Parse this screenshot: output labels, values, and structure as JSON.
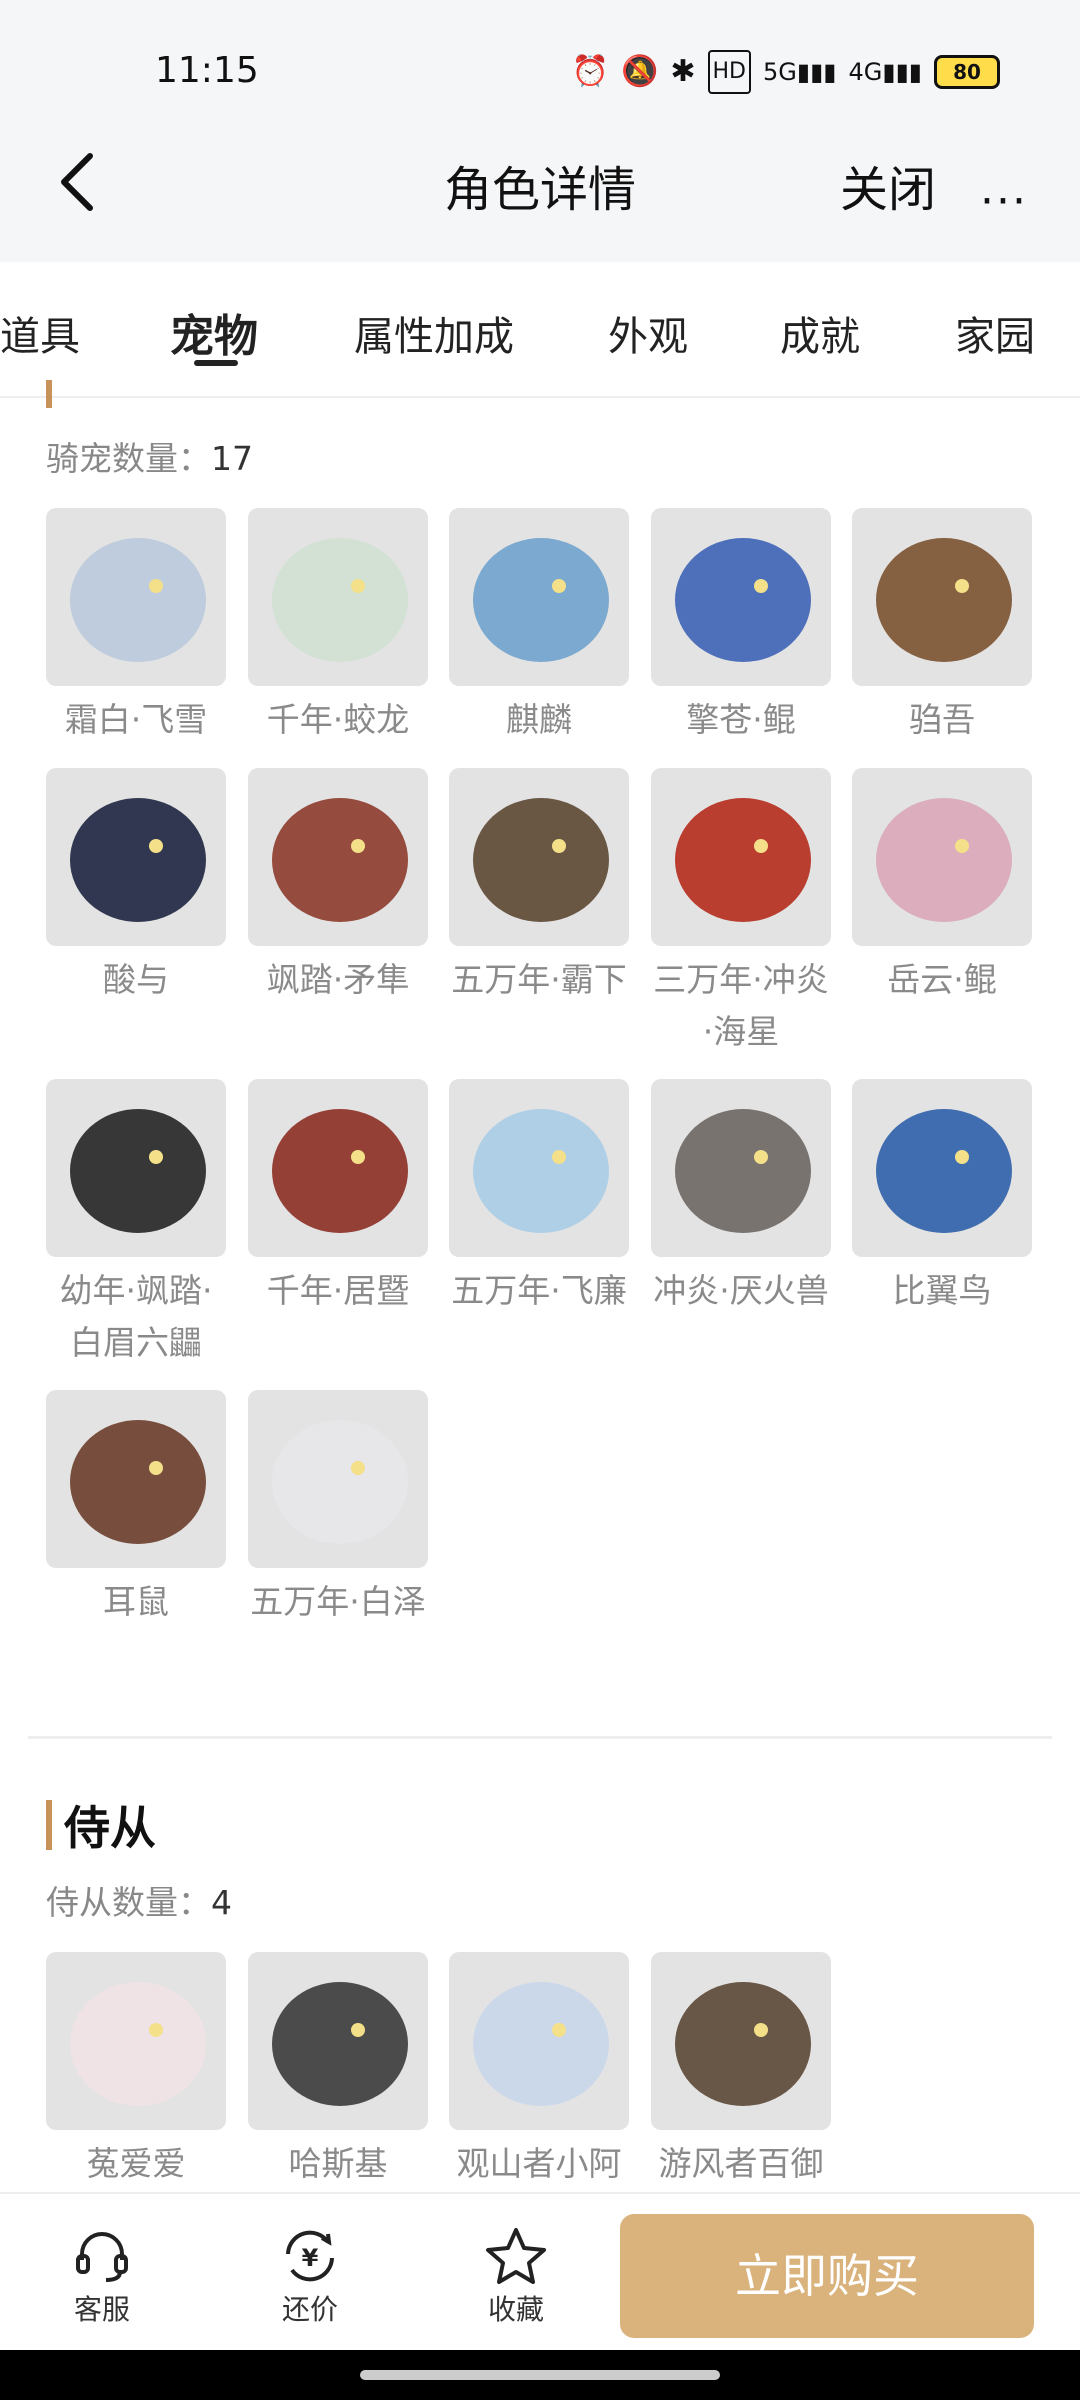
{
  "status": {
    "time": "11:15",
    "battery": "80"
  },
  "header": {
    "title": "角色详情",
    "close_label": "关闭",
    "more_label": "···"
  },
  "tabs": [
    "道具",
    "宠物",
    "属性加成",
    "外观",
    "成就",
    "家园"
  ],
  "mounts": {
    "count_label": "骑宠数量：",
    "count_value": "17",
    "items": [
      {
        "label": "霜白·飞雪",
        "color": "#b9c9dd"
      },
      {
        "label": "千年·蛟龙",
        "color": "#cfe0d2"
      },
      {
        "label": "麒麟",
        "color": "#6fa2cc"
      },
      {
        "label": "擎苍·鲲",
        "color": "#3d62b5"
      },
      {
        "label": "驺吾",
        "color": "#7a5230"
      },
      {
        "label": "酸与",
        "color": "#1d2340"
      },
      {
        "label": "飒踏·矛隼",
        "color": "#8c3a2a"
      },
      {
        "label": "五万年·霸下",
        "color": "#5b4732"
      },
      {
        "label": "三万年·冲炎·海星",
        "color": "#b42b1c"
      },
      {
        "label": "岳云·鲲",
        "color": "#d9a6b8"
      },
      {
        "label": "幼年·飒踏·白眉六鼺",
        "color": "#232323"
      },
      {
        "label": "千年·居暨",
        "color": "#8c2e24"
      },
      {
        "label": "五万年·飞廉",
        "color": "#a9cce6"
      },
      {
        "label": "冲炎·厌火兽",
        "color": "#6b6662"
      },
      {
        "label": "比翼鸟",
        "color": "#2d5fa8"
      },
      {
        "label": "耳鼠",
        "color": "#6a3d2a"
      },
      {
        "label": "五万年·白泽",
        "color": "#e7e7ea"
      }
    ]
  },
  "attendants": {
    "title": "侍从",
    "count_label": "侍从数量：",
    "count_value": "4",
    "items": [
      {
        "label": "菟爱爱",
        "color": "#f0e2e6"
      },
      {
        "label": "哈斯基",
        "color": "#3a3a3a"
      },
      {
        "label": "观山者小阿",
        "color": "#c8d6ea"
      },
      {
        "label": "游风者百御",
        "color": "#5a4634"
      }
    ]
  },
  "bottom": {
    "service_label": "客服",
    "bargain_label": "还价",
    "favorite_label": "收藏",
    "buy_label": "立即购买"
  }
}
